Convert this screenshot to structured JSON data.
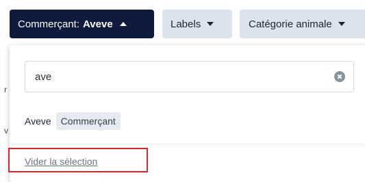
{
  "filters": {
    "merchant": {
      "label": "Commerçant:",
      "value": "Aveve",
      "state": "expanded",
      "icon": "caret-up-icon"
    },
    "labels": {
      "label": "Labels",
      "icon": "caret-down-icon"
    },
    "animal_category": {
      "label": "Catégorie animale",
      "icon": "caret-down-icon"
    }
  },
  "background_hints": [
    "r",
    "v"
  ],
  "dropdown": {
    "search": {
      "value": "ave",
      "placeholder": "",
      "clear_icon": "clear-circle-icon"
    },
    "options": [
      {
        "name": "Aveve",
        "type": "Commerçant"
      }
    ],
    "clear_selection_label": "Vider la sélection"
  },
  "colors": {
    "primary_dark": "#0f1b3d",
    "chip_background": "#dde3ec",
    "badge_background": "#e6ebf1",
    "highlight": "#e0242b",
    "link": "#6b7280"
  }
}
